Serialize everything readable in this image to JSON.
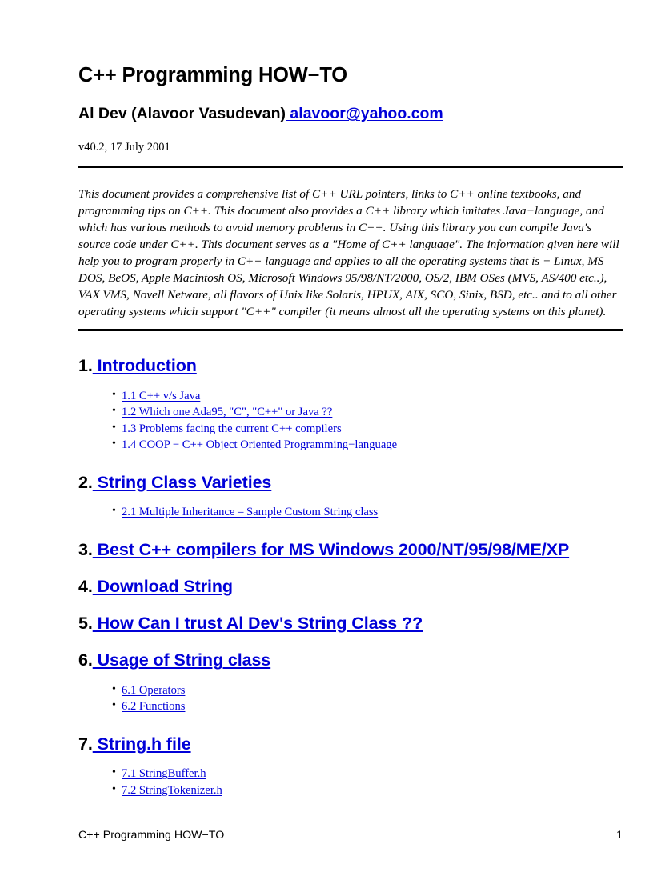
{
  "document": {
    "title": "C++ Programming HOW−TO",
    "author_prefix": "Al Dev (Alavoor Vasudevan)",
    "author_email": " alavoor@yahoo.com",
    "version_line": "v40.2, 17 July 2001",
    "abstract": "This document provides a comprehensive list of C++ URL pointers, links to C++ online textbooks, and programming tips on C++. This document also provides a C++ library which imitates Java−language, and which has various methods to avoid memory problems in C++. Using this library you can compile Java's source code under C++. This document serves as a \"Home of C++ language\". The information given here will help you to program properly in C++ language and applies to all the operating systems that is − Linux, MS DOS, BeOS, Apple Macintosh OS, Microsoft Windows 95/98/NT/2000, OS/2, IBM OSes (MVS, AS/400 etc..), VAX VMS, Novell Netware, all flavors of Unix like Solaris, HPUX, AIX, SCO, Sinix, BSD, etc.. and to all other operating systems which support \"C++\" compiler (it means almost all the operating systems on this planet)."
  },
  "colors": {
    "link": "#0000d8",
    "text": "#000000",
    "rule": "#000000",
    "background": "#ffffff"
  },
  "toc": {
    "sections": [
      {
        "number": "1.",
        "title": " Introduction",
        "items": [
          "1.1 C++ v/s Java",
          "1.2 Which one Ada95, \"C\", \"C++\" or Java ??",
          "1.3 Problems facing the current C++ compilers",
          "1.4 COOP − C++ Object Oriented Programming−language"
        ]
      },
      {
        "number": "2.",
        "title": " String Class Varieties ",
        "items": [
          "2.1 Multiple Inheritance – Sample Custom String class "
        ]
      },
      {
        "number": "3.",
        "title": " Best C++ compilers for MS Windows 2000/NT/95/98/ME/XP ",
        "items": []
      },
      {
        "number": "4.",
        "title": " Download String ",
        "items": []
      },
      {
        "number": "5.",
        "title": " How Can I trust Al Dev's String Class ?? ",
        "items": []
      },
      {
        "number": "6.",
        "title": " Usage of String class",
        "items": [
          "6.1 Operators",
          "6.2 Functions"
        ]
      },
      {
        "number": "7.",
        "title": " String.h file",
        "items": [
          "7.1 StringBuffer.h",
          "7.2 StringTokenizer.h"
        ]
      }
    ]
  },
  "footer": {
    "left": "C++ Programming HOW−TO",
    "page_number": "1"
  }
}
